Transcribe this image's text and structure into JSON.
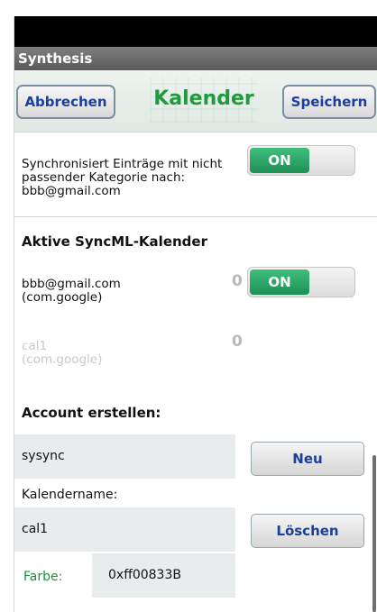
{
  "app": {
    "title": "Synthesis"
  },
  "header": {
    "cancel_label": "Abbrechen",
    "title": "Kalender",
    "save_label": "Speichern"
  },
  "sync_other": {
    "text_line1": "Synchronisiert Einträge mit nicht",
    "text_line2": "passender Kategorie nach:",
    "text_line3": "bbb@gmail.com",
    "toggle_label": "ON"
  },
  "active": {
    "title": "Aktive SyncML-Kalender",
    "calendars": [
      {
        "name": "bbb@gmail.com",
        "source": "(com.google)",
        "count": "0",
        "toggle_label": "ON",
        "enabled": true
      },
      {
        "name": "cal1",
        "source": "(com.google)",
        "count": "0",
        "enabled": false
      }
    ]
  },
  "account": {
    "title": "Account erstellen:",
    "account_name": "sysync",
    "new_label": "Neu",
    "calendar_name_label": "Kalendername:",
    "calendar_name": "cal1",
    "delete_label": "Löschen",
    "color_label": "Farbe:",
    "color_value": "0xff00833B"
  },
  "colors": {
    "accent_green": "#1f9a3e",
    "toggle_green": "#1e8f55",
    "button_text_blue": "#1a3f9c"
  }
}
